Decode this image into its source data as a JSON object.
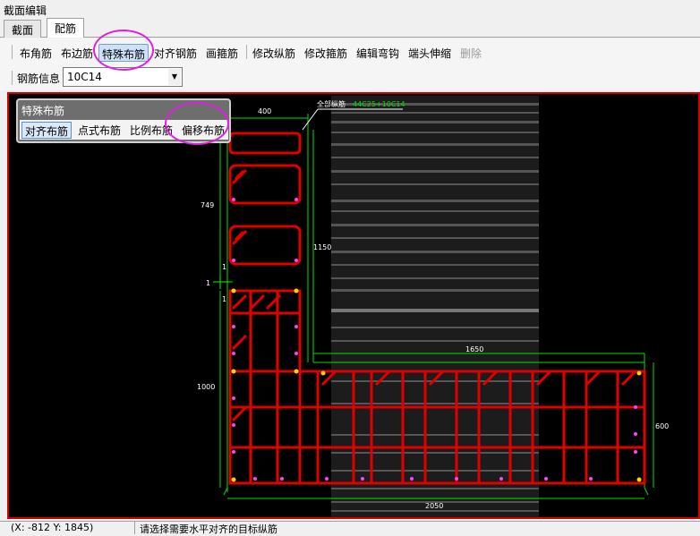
{
  "window": {
    "title": "截面编辑"
  },
  "tabs": [
    {
      "label": "截面"
    },
    {
      "label": "配筋"
    }
  ],
  "toolbar": {
    "items": [
      {
        "label": "布角筋"
      },
      {
        "label": "布边筋"
      },
      {
        "label": "特殊布筋"
      },
      {
        "label": "对齐钢筋"
      },
      {
        "label": "画箍筋"
      },
      {
        "label": "修改纵筋"
      },
      {
        "label": "修改箍筋"
      },
      {
        "label": "编辑弯钩"
      },
      {
        "label": "端头伸缩"
      },
      {
        "label": "删除"
      }
    ]
  },
  "rebar_info": {
    "label": "钢筋信息",
    "value": "10C14"
  },
  "special_panel": {
    "title": "特殊布筋",
    "buttons": [
      {
        "label": "对齐布筋"
      },
      {
        "label": "点式布筋"
      },
      {
        "label": "比例布筋"
      },
      {
        "label": "偏移布筋"
      }
    ]
  },
  "drawing": {
    "dims": {
      "top_width": "400",
      "left_upper": "749",
      "right_height": "1150",
      "small_1a": "1",
      "small_1b": "1",
      "small_1c": "1",
      "left_lower": "1000",
      "flange_width": "1650",
      "right_flange": "600",
      "bottom_width": "2050"
    },
    "annotation": {
      "prefix": "全部纵筋",
      "value": "44C25+10C14"
    }
  },
  "status": {
    "coords": "(X:  -812  Y: 1845)",
    "message": "请选择需要水平对齐的目标纵筋"
  },
  "colors": {
    "rebar": "#e00000",
    "dim": "#00e000",
    "highlight": "#e020e0",
    "canvas": "#000000"
  }
}
